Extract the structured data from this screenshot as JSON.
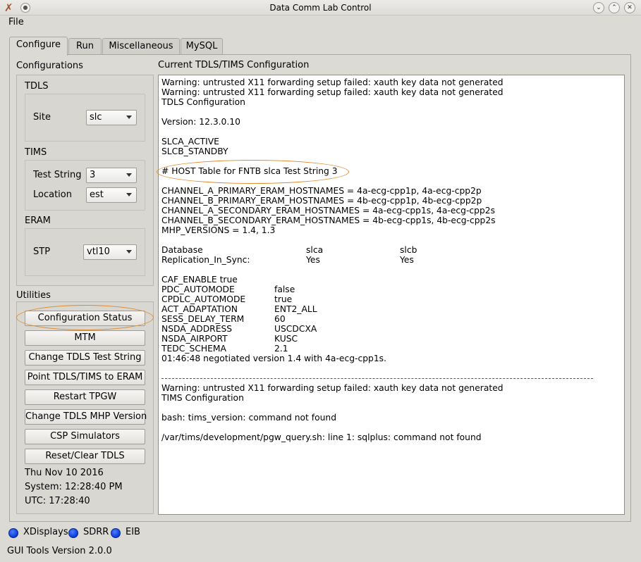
{
  "window": {
    "title": "Data Comm Lab Control"
  },
  "menu": {
    "file": "File"
  },
  "tabs": [
    "Configure",
    "Run",
    "Miscellaneous",
    "MySQL"
  ],
  "configurations": {
    "heading": "Configurations",
    "tdls": {
      "heading": "TDLS",
      "site_label": "Site",
      "site_value": "slc"
    },
    "tims": {
      "heading": "TIMS",
      "test_string_label": "Test String",
      "test_string_value": "3",
      "location_label": "Location",
      "location_value": "est"
    },
    "eram": {
      "heading": "ERAM",
      "stp_label": "STP",
      "stp_value": "vtl10"
    }
  },
  "utilities": {
    "heading": "Utilities",
    "buttons": [
      "Configuration Status",
      "MTM",
      "Change TDLS Test String",
      "Point TDLS/TIMS to ERAM",
      "Restart TPGW",
      "Change TDLS MHP Version",
      "CSP Simulators",
      "Reset/Clear TDLS"
    ],
    "date": "Thu Nov 10 2016",
    "system_time": "System: 12:28:40 PM",
    "utc_time": "UTC: 17:28:40"
  },
  "output": {
    "heading": "Current TDLS/TIMS Configuration",
    "lines": [
      "Warning: untrusted X11 forwarding setup failed: xauth key data not generated",
      "Warning: untrusted X11 forwarding setup failed: xauth key data not generated",
      "TDLS Configuration",
      "",
      "Version: 12.3.0.10",
      "",
      "SLCA_ACTIVE",
      "SLCB_STANDBY",
      "",
      "# HOST Table for FNTB slca Test String 3",
      "",
      "CHANNEL_A_PRIMARY_ERAM_HOSTNAMES = 4a-ecg-cpp1p, 4a-ecg-cpp2p",
      "CHANNEL_B_PRIMARY_ERAM_HOSTNAMES = 4b-ecg-cpp1p, 4b-ecg-cpp2p",
      "CHANNEL_A_SECONDARY_ERAM_HOSTNAMES = 4a-ecg-cpp1s, 4a-ecg-cpp2s",
      "CHANNEL_B_SECONDARY_ERAM_HOSTNAMES = 4b-ecg-cpp1s, 4b-ecg-cpp2s",
      "MHP_VERSIONS = 1.4, 1.3",
      "",
      [
        "Database",
        "slca",
        "slcb"
      ],
      [
        "Replication_In_Sync:",
        "Yes",
        "Yes"
      ],
      "",
      "CAF_ENABLE true",
      [
        "PDC_AUTOMODE",
        "false"
      ],
      [
        "CPDLC_AUTOMODE",
        "true"
      ],
      [
        "ACT_ADAPTATION",
        "ENT2_ALL"
      ],
      [
        "SESS_DELAY_TERM",
        "60"
      ],
      [
        "NSDA_ADDRESS",
        "USCDCXA"
      ],
      [
        "NSDA_AIRPORT",
        "KUSC"
      ],
      [
        "TEDC_SCHEMA",
        "2.1"
      ],
      "01:46:48 negotiated version 1.4 with 4a-ecg-cpp1s.",
      "",
      "---",
      "Warning: untrusted X11 forwarding setup failed: xauth key data not generated",
      "TIMS Configuration",
      "",
      "bash: tims_version: command not found",
      "",
      "/var/tims/development/pgw_query.sh: line 1: sqlplus: command not found"
    ]
  },
  "status": {
    "indicators": [
      "XDisplays",
      "SDRR",
      "EIB"
    ],
    "indicator_color": "#1048e0"
  },
  "footer": {
    "version": "GUI Tools Version 2.0.0"
  },
  "colors": {
    "highlight": "#e08a2a",
    "background": "#dcdad5"
  }
}
